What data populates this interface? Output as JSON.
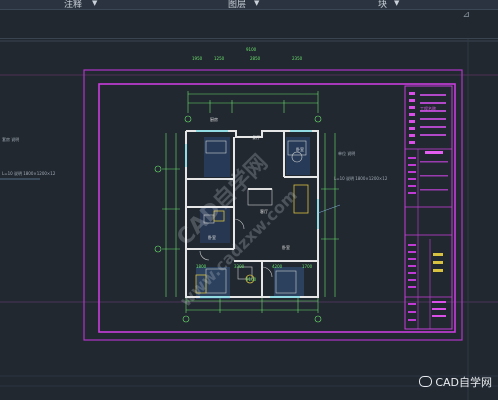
{
  "ribbon": {
    "panels": [
      {
        "label": "注释"
      },
      {
        "label": "图层"
      },
      {
        "label": "块"
      }
    ]
  },
  "drawing": {
    "left_note_1": "套房 说明",
    "left_note_2": "L=10 说明 1800×1200×12",
    "right_note_1": "单位 说明",
    "right_note_2": "L=10 说明 1800×1200×12",
    "dims_top": [
      "1950",
      "1250",
      "2850",
      "2350"
    ],
    "dims_bottom": [
      "1800",
      "3300",
      "4200",
      "1700"
    ],
    "overall_width": "9100",
    "room_labels": [
      "厨房",
      "餐厅",
      "卧室",
      "客厅",
      "卧室",
      "卧室"
    ],
    "title_block_heading": "工程名称"
  },
  "watermarks": {
    "main_1": "CAD自学网",
    "main_2": "www.cadzxw.com"
  },
  "brand": {
    "text": "CAD自学网"
  },
  "colors": {
    "background": "#212830",
    "frame_magenta": "#c83cdc",
    "wall_white": "#e6e6e6",
    "dim_green": "#6be36b",
    "hatch_blue": "#4a7bd8",
    "furniture_yellow": "#d8c040"
  }
}
